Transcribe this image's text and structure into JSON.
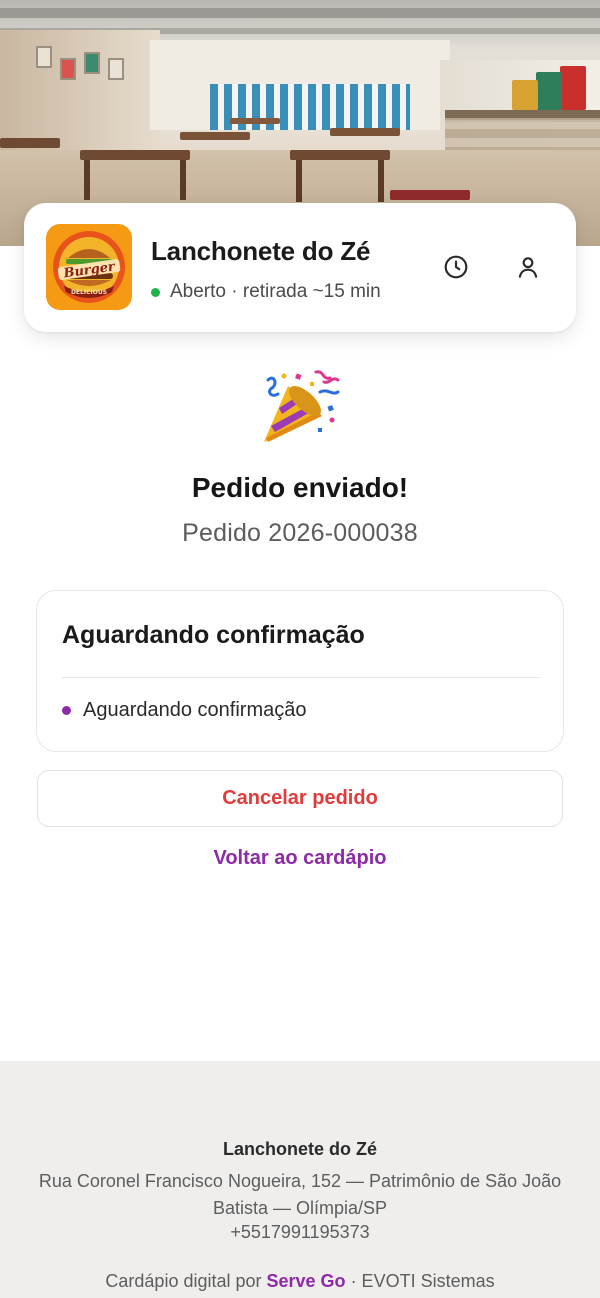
{
  "store": {
    "name": "Lanchonete do Zé",
    "status": "Aberto · retirada ~15 min",
    "status_color": "#22b24c",
    "logo_text": "Burger",
    "logo_subtext": "DELICIOUS",
    "logo_bg": "#f59a12"
  },
  "header_icons": {
    "history": "clock-icon",
    "profile": "user-icon"
  },
  "confirmation": {
    "emoji": "party-popper-icon",
    "title": "Pedido enviado!",
    "order_number": "Pedido 2026-000038"
  },
  "status_card": {
    "heading": "Aguardando confirmação",
    "timeline": [
      {
        "label": "Aguardando confirmação",
        "dot_color": "#8e2aa8"
      }
    ]
  },
  "actions": {
    "cancel_label": "Cancelar pedido",
    "cancel_color": "#e23b3b",
    "back_label": "Voltar ao cardápio",
    "accent_color": "#8e2aa8"
  },
  "footer": {
    "name": "Lanchonete do Zé",
    "address": "Rua Coronel Francisco Nogueira, 152 — Patrimônio de São João Batista — Olímpia/SP",
    "phone": "+5517991195373",
    "credit_prefix": "Cardápio digital por ",
    "credit_brand": "Serve Go",
    "credit_suffix": " · EVOTI Sistemas"
  }
}
